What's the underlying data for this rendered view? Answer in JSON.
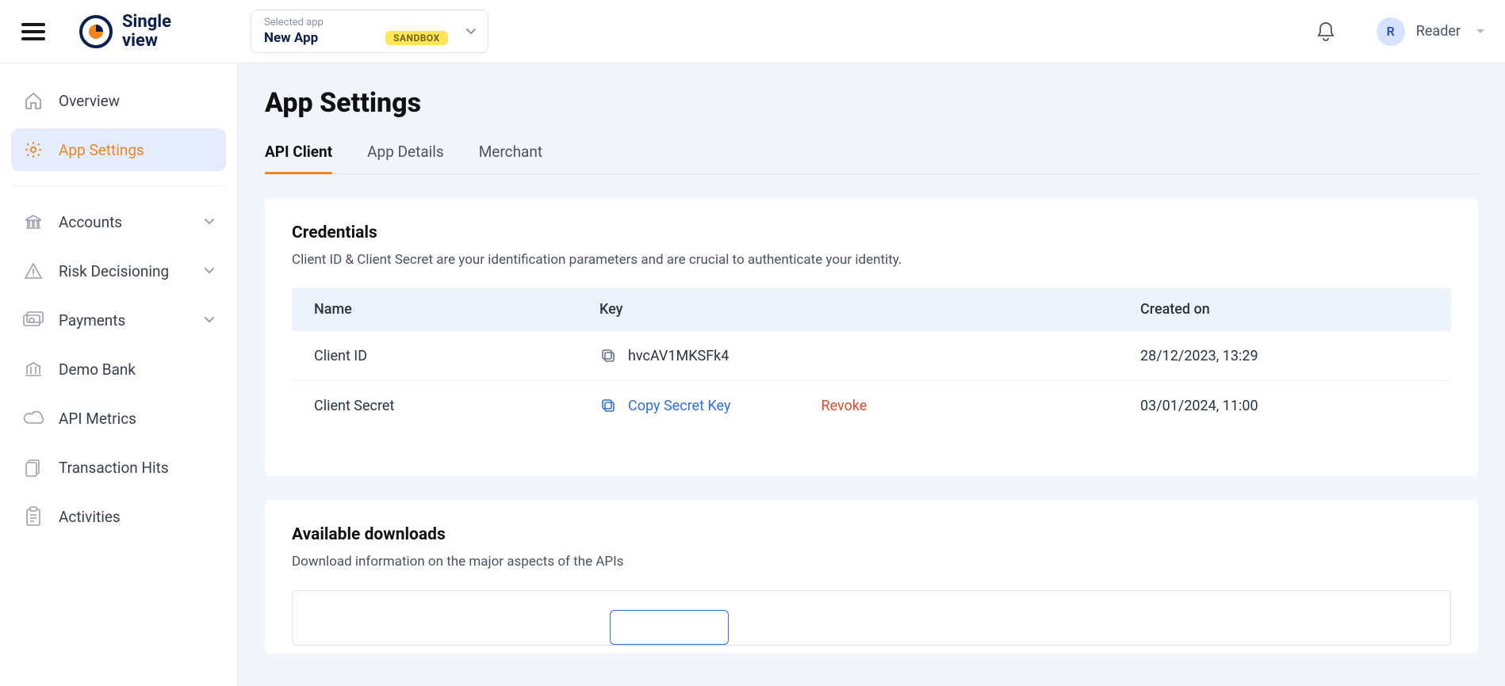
{
  "header": {
    "logo_line1": "Single",
    "logo_line2": "view",
    "selected_label": "Selected app",
    "selected_app": "New App",
    "env_badge": "SANDBOX",
    "user_initial": "R",
    "user_name": "Reader"
  },
  "sidebar": {
    "items": [
      {
        "label": "Overview",
        "icon": "home-icon",
        "expandable": false
      },
      {
        "label": "App Settings",
        "icon": "gear-icon",
        "expandable": false,
        "active": true
      },
      {
        "label": "Accounts",
        "icon": "bank-icon",
        "expandable": true
      },
      {
        "label": "Risk Decisioning",
        "icon": "warning-icon",
        "expandable": true
      },
      {
        "label": "Payments",
        "icon": "cash-icon",
        "expandable": true
      },
      {
        "label": "Demo Bank",
        "icon": "bank2-icon",
        "expandable": false
      },
      {
        "label": "API Metrics",
        "icon": "cloud-icon",
        "expandable": false
      },
      {
        "label": "Transaction Hits",
        "icon": "doc-icon",
        "expandable": false
      },
      {
        "label": "Activities",
        "icon": "clipboard-icon",
        "expandable": false
      }
    ]
  },
  "page": {
    "title": "App Settings",
    "tabs": [
      {
        "label": "API Client",
        "active": true
      },
      {
        "label": "App Details",
        "active": false
      },
      {
        "label": "Merchant",
        "active": false
      }
    ]
  },
  "credentials": {
    "heading": "Credentials",
    "description": "Client ID & Client Secret are your identification parameters and are crucial to authenticate your identity.",
    "columns": {
      "name": "Name",
      "key": "Key",
      "created": "Created on"
    },
    "rows": [
      {
        "name": "Client ID",
        "key_text": "hvcAV1MKSFk4",
        "created": "28/12/2023, 13:29",
        "copy_action_label": "",
        "revoke_label": ""
      },
      {
        "name": "Client Secret",
        "key_text": "Copy Secret Key",
        "created": "03/01/2024, 11:00",
        "copy_action_label": "Copy Secret Key",
        "revoke_label": "Revoke"
      }
    ]
  },
  "downloads": {
    "heading": "Available downloads",
    "description": "Download information on the major aspects of the APIs"
  }
}
